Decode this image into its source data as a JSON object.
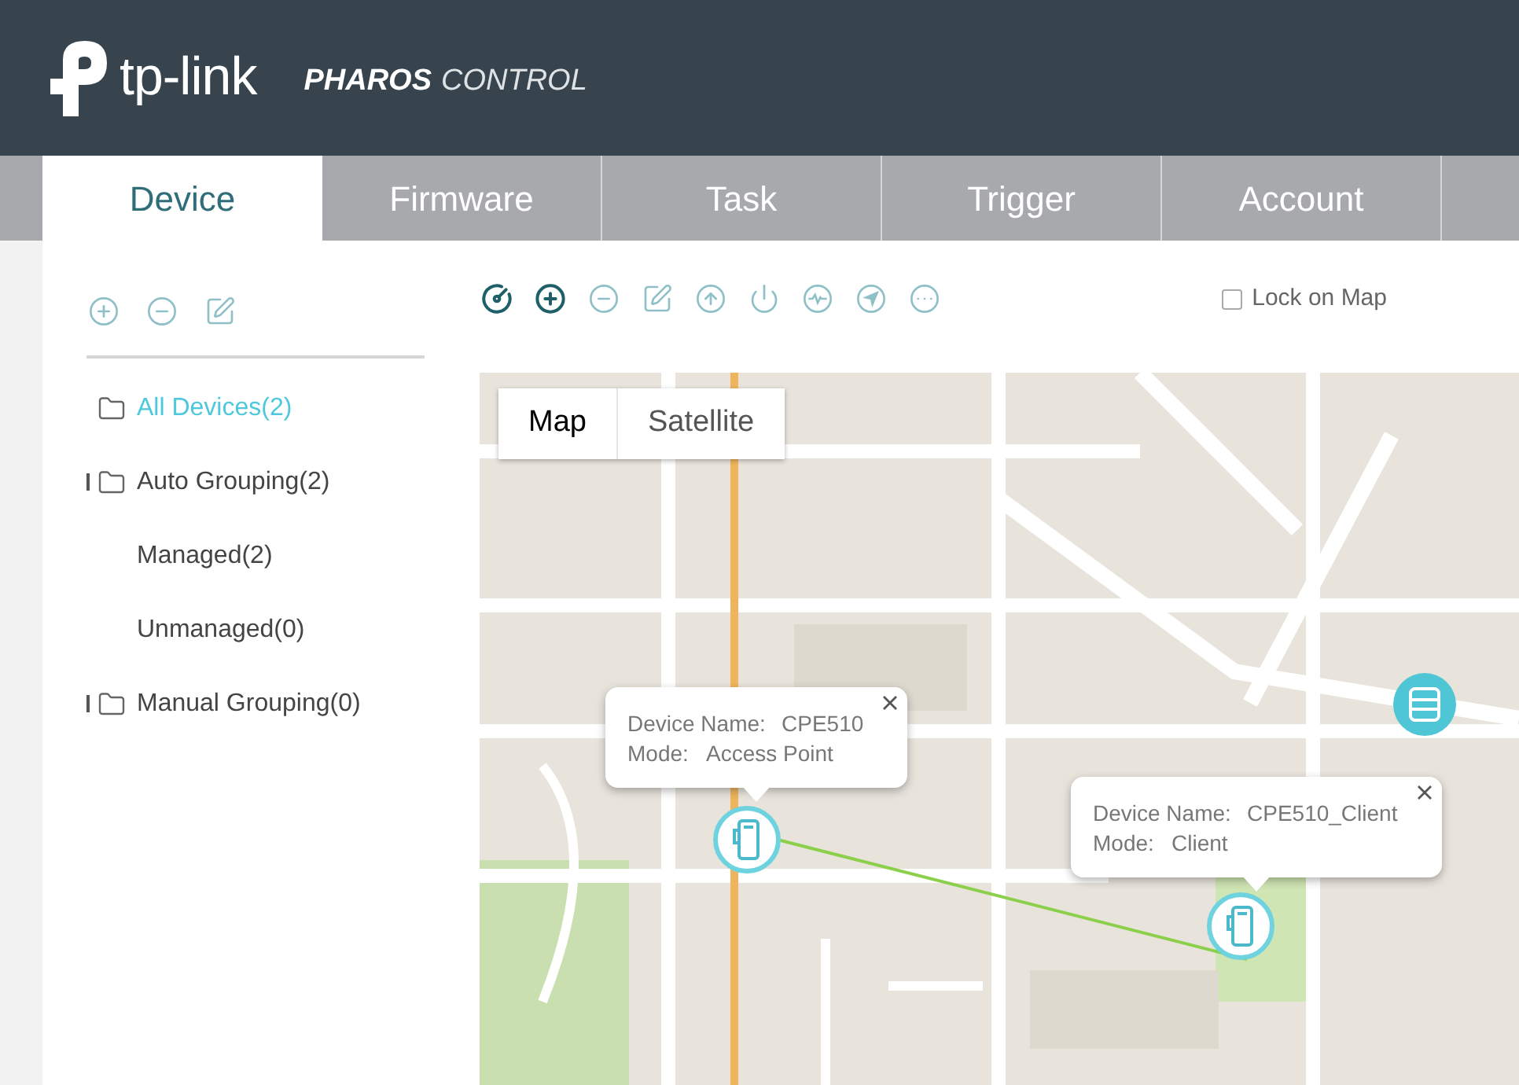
{
  "header": {
    "brand": "tp-link",
    "product_bold": "PHAROS",
    "product_light": "CONTROL"
  },
  "tabs": [
    {
      "label": "Device",
      "selected": true
    },
    {
      "label": "Firmware",
      "selected": false
    },
    {
      "label": "Task",
      "selected": false
    },
    {
      "label": "Trigger",
      "selected": false
    },
    {
      "label": "Account",
      "selected": false
    }
  ],
  "sidebar": {
    "toolbar": [
      {
        "kind": "add",
        "disabled": true
      },
      {
        "kind": "remove",
        "disabled": true
      },
      {
        "kind": "edit",
        "disabled": true
      }
    ],
    "tree": [
      {
        "label": "All Devices(2)",
        "selected": true,
        "folder": true,
        "toggle": false
      },
      {
        "label": "Auto Grouping(2)",
        "selected": false,
        "folder": true,
        "toggle": true,
        "children": [
          {
            "label": "Managed(2)",
            "selected": false,
            "folder": false,
            "toggle": false
          },
          {
            "label": "Unmanaged(0)",
            "selected": false,
            "folder": false,
            "toggle": false
          }
        ]
      },
      {
        "label": "Manual Grouping(0)",
        "selected": false,
        "folder": true,
        "toggle": true
      }
    ]
  },
  "map_toolbar": [
    {
      "kind": "locate",
      "disabled": false
    },
    {
      "kind": "add",
      "disabled": false
    },
    {
      "kind": "remove",
      "disabled": true
    },
    {
      "kind": "edit",
      "disabled": true
    },
    {
      "kind": "upgrade",
      "disabled": true
    },
    {
      "kind": "power",
      "disabled": true
    },
    {
      "kind": "pulse",
      "disabled": true
    },
    {
      "kind": "navigate",
      "disabled": true
    },
    {
      "kind": "more",
      "disabled": true
    }
  ],
  "lock_on_map": {
    "label": "Lock on Map",
    "checked": false
  },
  "map": {
    "kind": "picture",
    "view_buttons": [
      {
        "label": "Map",
        "selected": true
      },
      {
        "label": "Satellite",
        "selected": false
      }
    ],
    "popups": [
      {
        "name_label": "Device Name:",
        "name": "CPE510",
        "mode_label": "Mode:",
        "mode": "Access Point"
      },
      {
        "name_label": "Device Name:",
        "name": "CPE510_Client",
        "mode_label": "Mode:",
        "mode": "Client"
      }
    ]
  }
}
